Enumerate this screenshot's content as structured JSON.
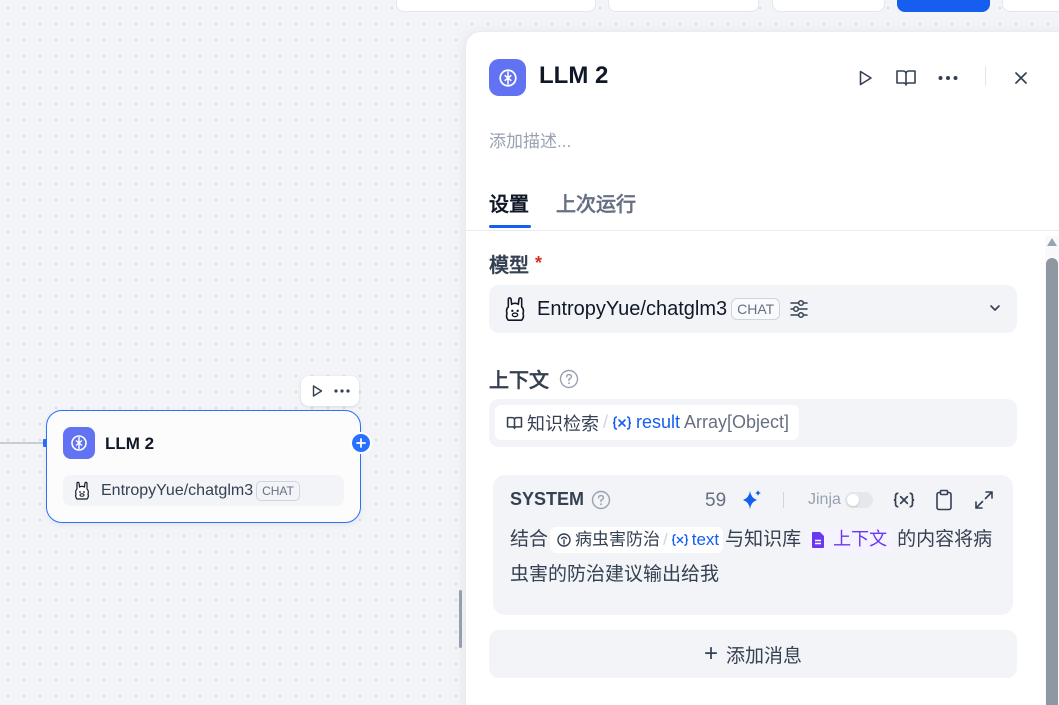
{
  "canvas": {
    "node": {
      "title": "LLM 2",
      "model_name": "EntropyYue/chatglm3",
      "model_mode": "CHAT"
    }
  },
  "panel": {
    "title": "LLM 2",
    "description_placeholder": "添加描述...",
    "tabs": [
      {
        "label": "设置",
        "active": true
      },
      {
        "label": "上次运行",
        "active": false
      }
    ],
    "model": {
      "label": "模型",
      "required_mark": "*",
      "name": "EntropyYue/chatglm3",
      "mode": "CHAT"
    },
    "context": {
      "label": "上下文",
      "variable": {
        "node_name": "知识检索",
        "separator": "/",
        "var_name": "result",
        "var_type": "Array[Object]"
      }
    },
    "prompt": {
      "role": "SYSTEM",
      "token_count": "59",
      "jinja_label": "Jinja",
      "jinja_enabled": false,
      "text_part1": "结合",
      "inline_var": {
        "node_name": "病虫害防治",
        "separator": "/",
        "var_name": "text"
      },
      "text_part2": "与知识库",
      "context_chip_label": "上下文",
      "text_part3": "的内容将病虫害的防治建议输出给我"
    },
    "add_message_label": "添加消息"
  },
  "colors": {
    "primary": "#155eef",
    "node_icon_bg": "#6172f3",
    "context_purple": "#6938ef",
    "required": "#d92d20"
  }
}
